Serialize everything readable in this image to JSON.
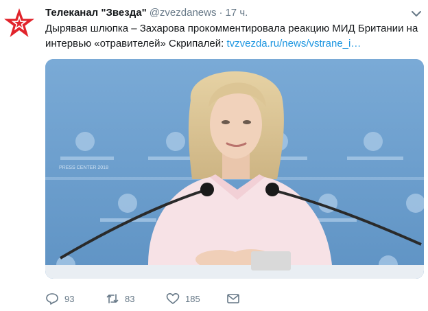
{
  "tweet": {
    "display_name": "Телеканал \"Звезда\"",
    "handle": "@zvezdanews",
    "separator": "·",
    "time": "17 ч.",
    "text_before_link": "Дырявая шлюпка – Захарова прокомментировала реакцию МИД Британии на интервью «отравителей» Скрипалей: ",
    "link_text": "tvzvezda.ru/news/vstrane_i…"
  },
  "actions": {
    "reply_count": "93",
    "retweet_count": "83",
    "like_count": "185"
  },
  "photo": {
    "backdrop_text": "PRESS CENTER 2018"
  },
  "colors": {
    "brand_red": "#e1232b",
    "link": "#1b95e0",
    "muted": "#657786",
    "backdrop_blue": "#6d9fcc"
  },
  "icons": {
    "avatar": "zvezda-star-icon",
    "menu": "chevron-down-icon",
    "reply": "reply-icon",
    "retweet": "retweet-icon",
    "like": "heart-icon",
    "message": "envelope-icon"
  }
}
